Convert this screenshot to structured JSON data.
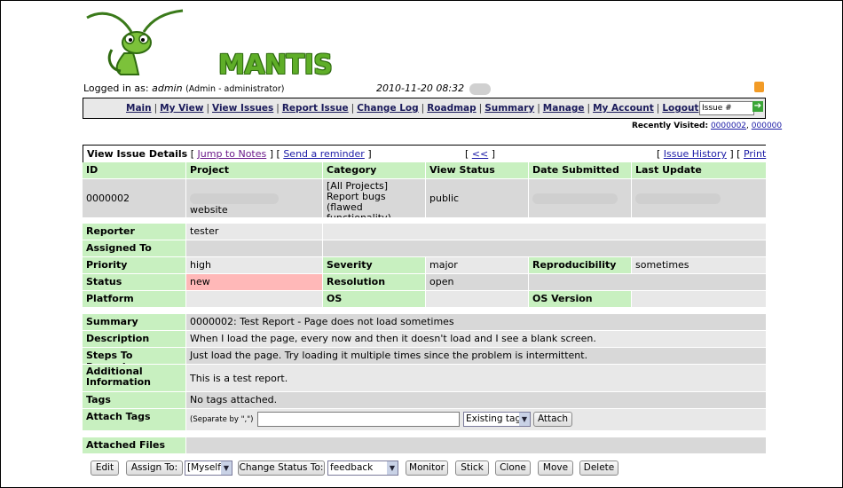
{
  "app": {
    "logo_text": "MANTIS",
    "logged_in_label": "Logged in as:",
    "user": "admin",
    "role": "(Admin - administrator)",
    "datetime": "2010-11-20 08:32"
  },
  "menu": {
    "items": [
      "Main",
      "My View",
      "View Issues",
      "Report Issue",
      "Change Log",
      "Roadmap",
      "Summary",
      "Manage",
      "My Account",
      "Logout"
    ],
    "issue_placeholder": "Issue #"
  },
  "recent": {
    "label": "Recently Visited:",
    "items": [
      "0000002",
      "000000"
    ]
  },
  "details": {
    "title": "View Issue Details",
    "jump_notes": "Jump to Notes",
    "send_reminder": "Send a reminder",
    "prev": "<<",
    "history": "Issue History",
    "print": "Print",
    "headers": [
      "ID",
      "Project",
      "Category",
      "View Status",
      "Date Submitted",
      "Last Update"
    ],
    "id": "0000002",
    "project": "website",
    "category": "[All Projects] Report bugs (flawed functionality)",
    "view_status": "public",
    "reporter_label": "Reporter",
    "reporter": "tester",
    "assigned_label": "Assigned To",
    "priority_label": "Priority",
    "priority": "high",
    "severity_label": "Severity",
    "severity": "major",
    "reproducibility_label": "Reproducibility",
    "reproducibility": "sometimes",
    "status_label": "Status",
    "status": "new",
    "resolution_label": "Resolution",
    "resolution": "open",
    "platform_label": "Platform",
    "os_label": "OS",
    "os_version_label": "OS Version",
    "summary_label": "Summary",
    "summary": "0000002: Test Report - Page does not load sometimes",
    "description_label": "Description",
    "description": "When I load the page, every now and then it doesn't load and I see a blank screen.",
    "steps_label": "Steps To Reproduce",
    "steps": "Just load the page. Try loading it multiple times since the problem is intermittent.",
    "additional_label": "Additional Information",
    "additional": "This is a test report.",
    "tags_label": "Tags",
    "tags": "No tags attached.",
    "attach_tags_label": "Attach Tags",
    "separate_hint": "(Separate by \",\")",
    "existing_tags": "Existing tags",
    "attach_button": "Attach",
    "attached_files_label": "Attached Files"
  },
  "actions": {
    "edit": "Edit",
    "assign_to": "Assign To:",
    "assign_value": "[Myself]",
    "change_status": "Change Status To:",
    "status_value": "feedback",
    "monitor": "Monitor",
    "stick": "Stick",
    "clone": "Clone",
    "move": "Move",
    "delete": "Delete"
  },
  "colors": {
    "label_green": "#c8f0c0",
    "status_new": "#ffb8b8",
    "logo_green": "#5fae28"
  }
}
